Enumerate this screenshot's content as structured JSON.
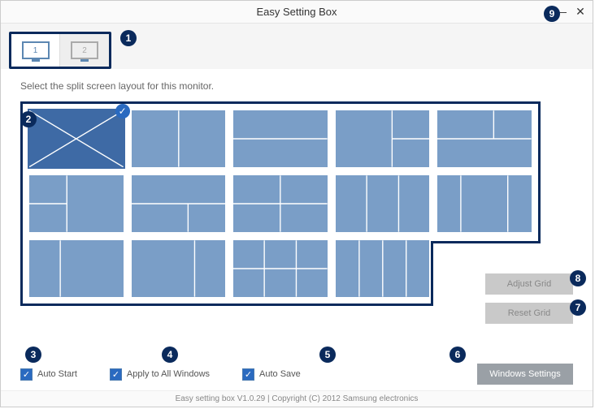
{
  "window": {
    "title": "Easy Setting Box"
  },
  "tabs": {
    "m1": "1",
    "m2": "2"
  },
  "instruction": "Select the split screen layout for this monitor.",
  "buttons": {
    "adjust_grid": "Adjust Grid",
    "reset_grid": "Reset Grid",
    "windows_settings": "Windows Settings"
  },
  "checks": {
    "auto_start": "Auto Start",
    "apply_all": "Apply to All Windows",
    "auto_save": "Auto Save"
  },
  "callouts": {
    "c1": "1",
    "c2": "2",
    "c3": "3",
    "c4": "4",
    "c5": "5",
    "c6": "6",
    "c7": "7",
    "c8": "8",
    "c9": "9"
  },
  "copyright": "Easy setting box V1.0.29 | Copyright (C) 2012 Samsung electronics"
}
